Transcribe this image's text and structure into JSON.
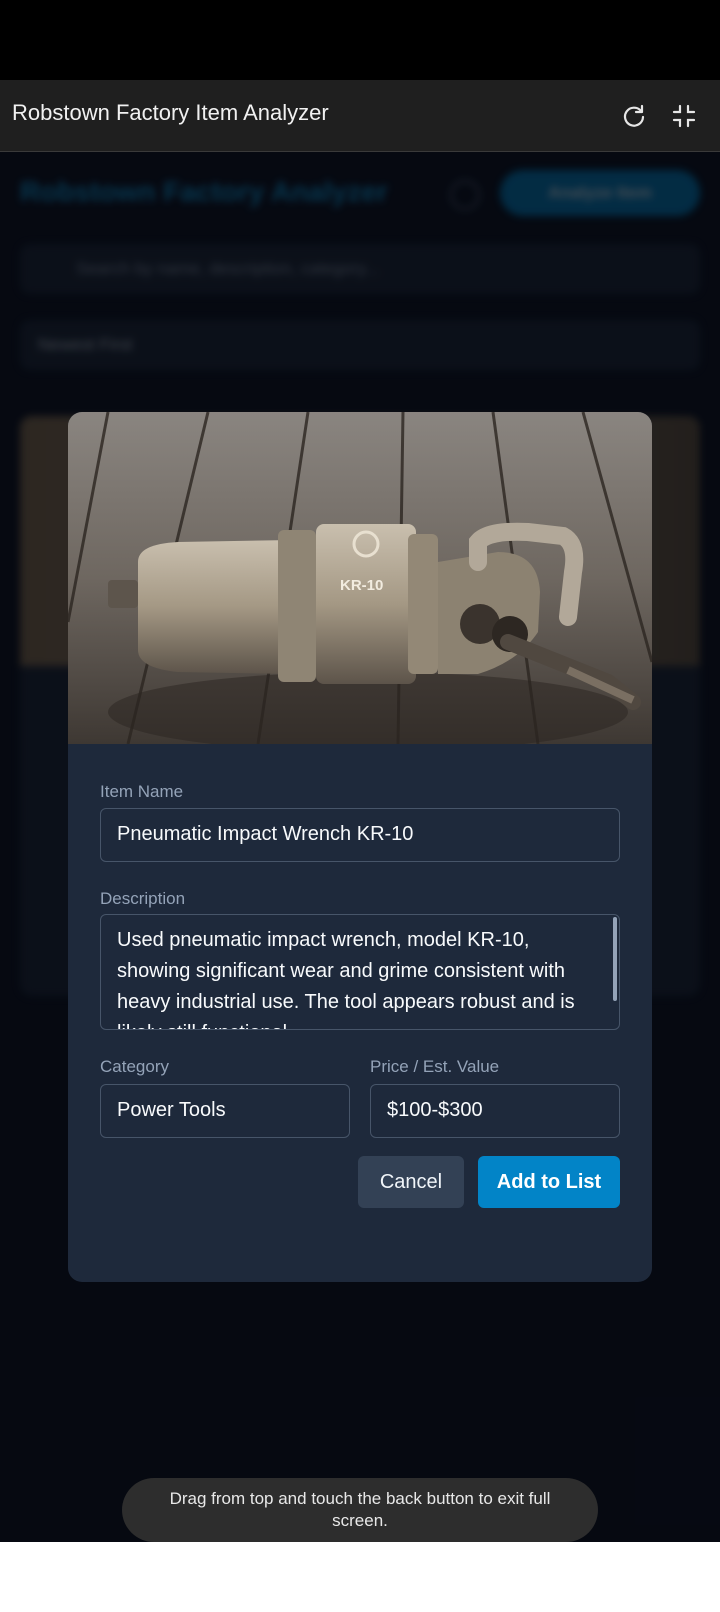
{
  "app": {
    "title": "Robstown Factory Item Analyzer",
    "icons": [
      "refresh-icon",
      "exit-fullscreen-icon"
    ]
  },
  "background": {
    "title": "Robstown Factory Analyzer",
    "add_button": "Analyze Item",
    "search_placeholder": "Search by name, description, category...",
    "sort_label": "Newest First"
  },
  "modal": {
    "image_alt": "Pneumatic impact wrench KR-10 on wooden floor",
    "image_text": "KR-10",
    "item_name_label": "Item Name",
    "item_name_value": "Pneumatic Impact Wrench KR-10",
    "description_label": "Description",
    "description_value": "Used pneumatic impact wrench, model KR-10, showing significant wear and grime consistent with heavy industrial use. The tool appears robust and is likely still functional.",
    "category_label": "Category",
    "category_value": "Power Tools",
    "price_label": "Price / Est. Value",
    "price_value": "$100-$300",
    "cancel_label": "Cancel",
    "add_label": "Add to List"
  },
  "toast": {
    "message": "Drag from top and touch the back button to exit full screen."
  },
  "colors": {
    "accent": "#0284c7",
    "modal_bg": "#1e293b",
    "page_bg": "#0b1120"
  }
}
